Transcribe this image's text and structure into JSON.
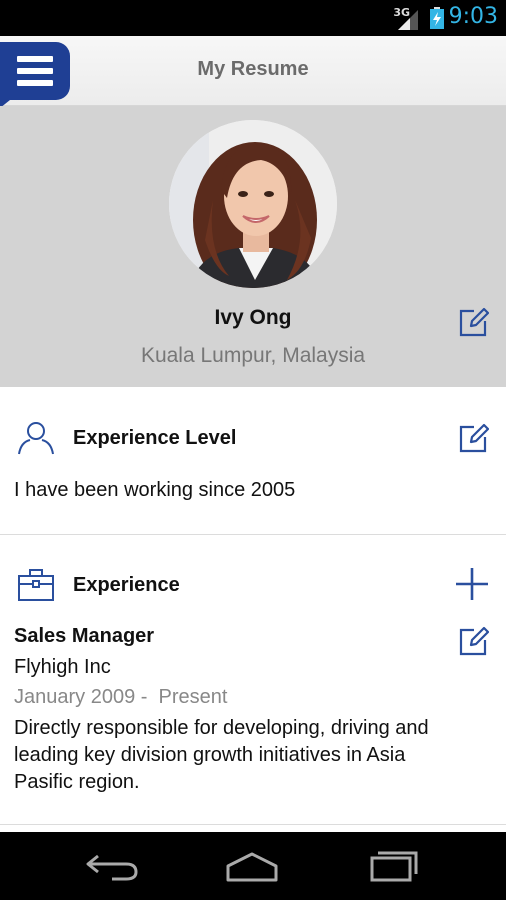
{
  "status_bar": {
    "network": "3G",
    "time": "9:03",
    "icons": [
      "signal-icon",
      "battery-charging-icon"
    ]
  },
  "app_bar": {
    "title": "My Resume",
    "menu_icon": "hamburger-menu-icon"
  },
  "profile": {
    "name": "Ivy Ong",
    "location": "Kuala Lumpur, Malaysia",
    "edit_icon": "edit-icon"
  },
  "experience_level": {
    "icon": "person-icon",
    "title": "Experience Level",
    "text": "I have been working since 2005",
    "edit_icon": "edit-icon"
  },
  "experience": {
    "icon": "briefcase-icon",
    "title": "Experience",
    "add_icon": "plus-icon",
    "items": [
      {
        "title": "Sales Manager",
        "company": "Flyhigh Inc",
        "dates": "January 2009 -  Present",
        "description": "Directly responsible for developing, driving and leading key division growth initiatives in Asia Pasific region."
      }
    ]
  },
  "nav_bar": {
    "icons": [
      "back-icon",
      "home-icon",
      "recent-apps-icon"
    ]
  },
  "colors": {
    "accent": "#1f3f94",
    "icon_blue": "#2a4f9e",
    "profile_bg": "#d3d3d3",
    "clock": "#33b5e5"
  }
}
